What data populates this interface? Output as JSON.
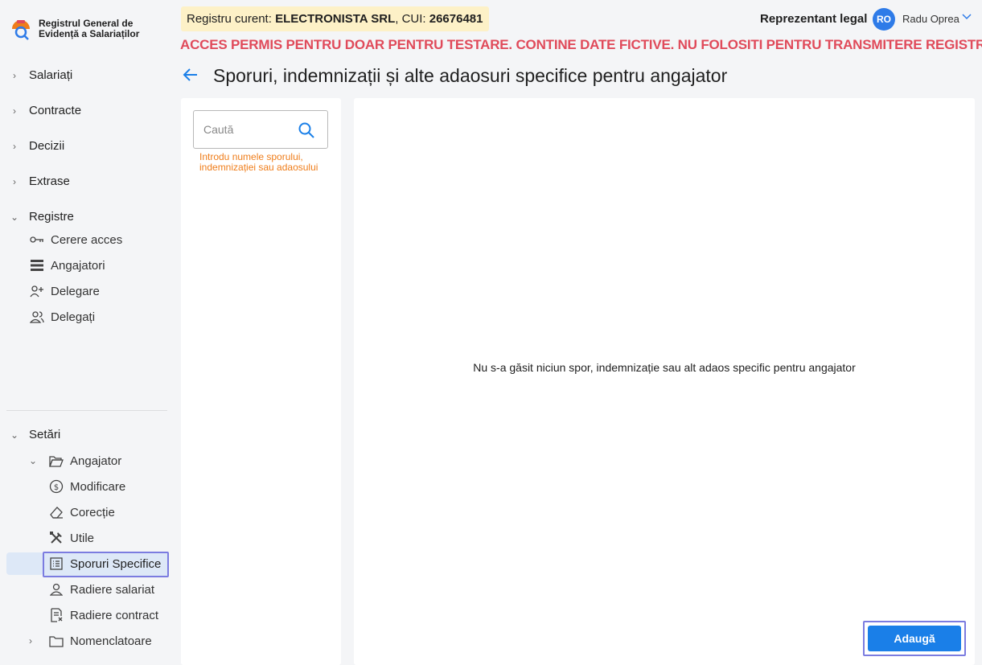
{
  "app": {
    "logo_line1": "Registrul General de",
    "logo_line2": "Evidență a Salariaților"
  },
  "header": {
    "registry_label": "Registru curent:",
    "registry_company": "ELECTRONISTA SRL",
    "registry_cui_label": ", CUI:",
    "registry_cui": "26676481",
    "warning": "ACCES PERMIS PENTRU DOAR PENTRU TESTARE. CONTINE DATE FICTIVE. NU FOLOSITI PENTRU TRANSMITERE REGISTRU",
    "role": "Reprezentant legal",
    "avatar_initials": "RO",
    "user_name": "Radu Oprea"
  },
  "page": {
    "title": "Sporuri, indemnizații și alte adaosuri specifice pentru angajator",
    "search_placeholder": "Caută",
    "search_hint": "Introdu numele sporului, indemnizației sau adaosului",
    "empty_message": "Nu s-a găsit niciun spor, indemnizație sau alt adaos specific pentru angajator",
    "add_label": "Adaugă"
  },
  "sidebar": {
    "items": [
      {
        "label": "Salariați"
      },
      {
        "label": "Contracte"
      },
      {
        "label": "Decizii"
      },
      {
        "label": "Extrase"
      },
      {
        "label": "Registre"
      }
    ],
    "registre_sub": [
      {
        "label": "Cerere acces",
        "icon": "key-icon"
      },
      {
        "label": "Angajatori",
        "icon": "list-icon"
      },
      {
        "label": "Delegare",
        "icon": "user-add-icon"
      },
      {
        "label": "Delegați",
        "icon": "users-icon"
      }
    ],
    "settings_label": "Setări",
    "angajator_label": "Angajator",
    "angajator_sub": [
      {
        "label": "Modificare",
        "icon": "refresh-icon"
      },
      {
        "label": "Corecție",
        "icon": "eraser-icon"
      },
      {
        "label": "Utile",
        "icon": "tools-icon"
      },
      {
        "label": "Sporuri Specifice",
        "icon": "document-list-icon"
      },
      {
        "label": "Radiere salariat",
        "icon": "user-icon"
      },
      {
        "label": "Radiere contract",
        "icon": "document-remove-icon"
      }
    ],
    "nomenclatoare_label": "Nomenclatoare"
  },
  "colors": {
    "accent": "#1a7fe8",
    "warning": "#e04a5a",
    "hint": "#ef7d1a",
    "highlight_border": "#7b7ce0"
  }
}
